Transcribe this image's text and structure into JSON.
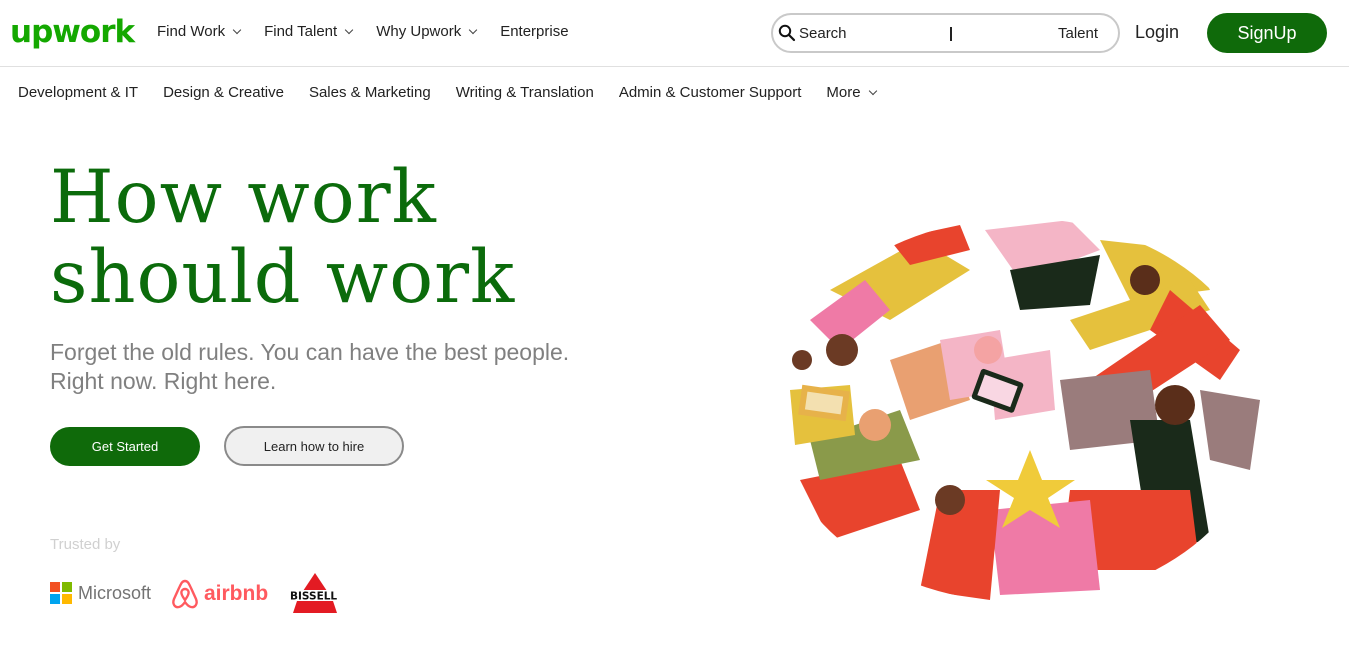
{
  "header": {
    "logo": "upwork",
    "nav": [
      {
        "label": "Find Work",
        "has_dropdown": true
      },
      {
        "label": "Find Talent",
        "has_dropdown": true
      },
      {
        "label": "Why Upwork",
        "has_dropdown": true
      },
      {
        "label": "Enterprise",
        "has_dropdown": false
      }
    ],
    "search": {
      "placeholder": "Search",
      "scope": "Talent"
    },
    "login_label": "Login",
    "signup_label": "SignUp"
  },
  "categories": [
    {
      "label": "Development & IT"
    },
    {
      "label": "Design & Creative"
    },
    {
      "label": "Sales & Marketing"
    },
    {
      "label": "Writing & Translation"
    },
    {
      "label": "Admin & Customer Support"
    },
    {
      "label": "More",
      "has_dropdown": true
    }
  ],
  "hero": {
    "title_line1": "How work",
    "title_line2": "should work",
    "subtitle_line1": "Forget the old rules. You can have the best people.",
    "subtitle_line2": "Right now. Right here.",
    "primary_button": "Get Started",
    "secondary_button": "Learn how to hire"
  },
  "trusted": {
    "label": "Trusted by",
    "brands": [
      "Microsoft",
      "airbnb",
      "BISSELL"
    ]
  },
  "colors": {
    "brand_green": "#14a800",
    "button_green": "#0f6a0a",
    "title_green": "#0b6b0b"
  }
}
